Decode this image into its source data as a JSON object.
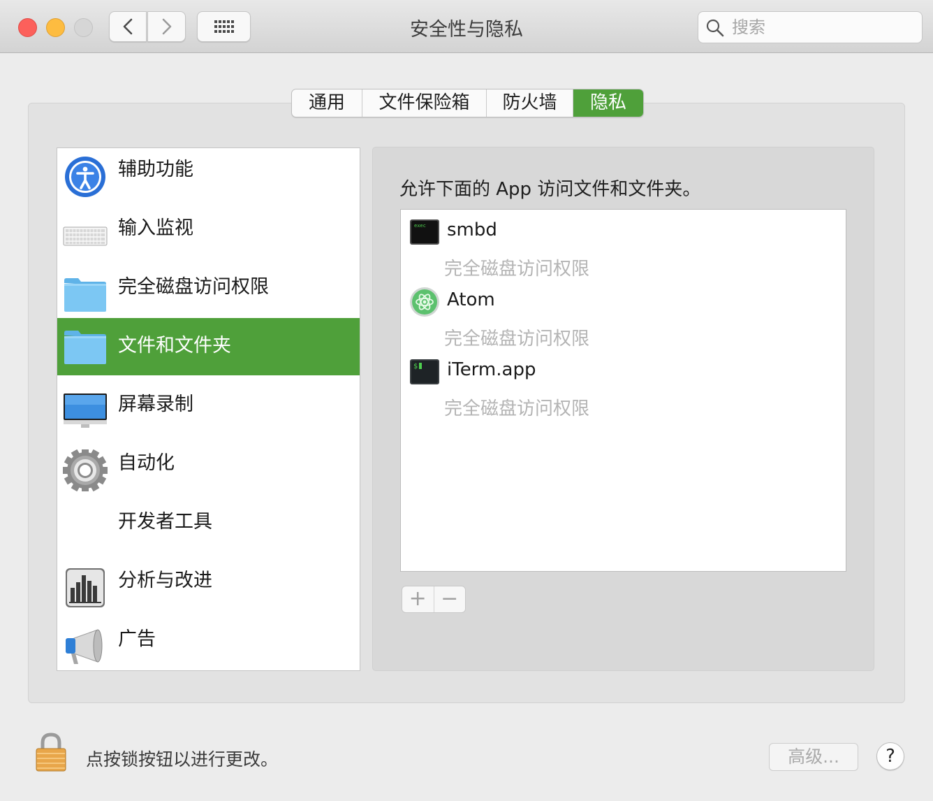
{
  "window": {
    "title": "安全性与隐私"
  },
  "toolbar": {
    "search_placeholder": "搜索"
  },
  "tabs": [
    {
      "label": "通用",
      "selected": false
    },
    {
      "label": "文件保险箱",
      "selected": false
    },
    {
      "label": "防火墙",
      "selected": false
    },
    {
      "label": "隐私",
      "selected": true
    }
  ],
  "sidebar": {
    "items": [
      {
        "label": "辅助功能",
        "icon": "accessibility-icon"
      },
      {
        "label": "输入监视",
        "icon": "keyboard-icon"
      },
      {
        "label": "完全磁盘访问权限",
        "icon": "folder-icon"
      },
      {
        "label": "文件和文件夹",
        "icon": "folder-icon",
        "selected": true
      },
      {
        "label": "屏幕录制",
        "icon": "display-icon"
      },
      {
        "label": "自动化",
        "icon": "gear-icon"
      },
      {
        "label": "开发者工具",
        "icon": ""
      },
      {
        "label": "分析与改进",
        "icon": "bar-chart-icon"
      },
      {
        "label": "广告",
        "icon": "megaphone-icon"
      }
    ]
  },
  "main": {
    "hint": "允许下面的 App 访问文件和文件夹。",
    "apps": [
      {
        "name": "smbd",
        "subtitle": "完全磁盘访问权限",
        "icon": "exec-terminal-icon"
      },
      {
        "name": "Atom",
        "subtitle": "完全磁盘访问权限",
        "icon": "atom-icon"
      },
      {
        "name": "iTerm.app",
        "subtitle": "完全磁盘访问权限",
        "icon": "iterm-icon"
      }
    ],
    "add_label": "+",
    "remove_label": "−"
  },
  "footer": {
    "lock_message": "点按锁按钮以进行更改。",
    "advanced_label": "高级...",
    "help_label": "?"
  },
  "colors": {
    "accent": "#4fa03a",
    "close": "#fc605b",
    "minimize": "#fdbc40",
    "zoom_disabled": "#d0d0d0"
  }
}
